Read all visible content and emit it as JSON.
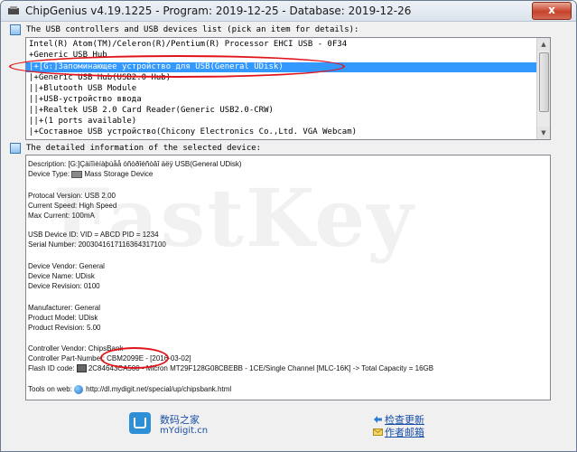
{
  "window": {
    "title": "ChipGenius v4.19.1225 - Program: 2019-12-25 - Database: 2019-12-26",
    "close_label": "x"
  },
  "devices_section": {
    "header": "The USB controllers and USB devices list (pick an item for details):",
    "items": [
      "Intel(R) Atom(TM)/Celeron(R)/Pentium(R) Processor EHCI USB - 0F34",
      "+Generic USB Hub",
      "|+[G:]Запоминающее устройство для USB(General UDisk)",
      "|+Generic USB Hub(USB2.0 Hub)",
      "||+Blutooth USB Module",
      "||+USB-устройство ввода",
      "||+Realtek USB 2.0 Card Reader(Generic USB2.0-CRW)",
      "||+(1 ports available)",
      "|+Составное USB устройство(Chicony Electronics Co.,Ltd. VGA Webcam)"
    ],
    "selected_index": 2
  },
  "details_section": {
    "header": "The detailed information of the selected device:",
    "lines": [
      {
        "label": "Description:",
        "value": "[G:]Çàïîìèíàþùåå óñòðîéñòâî äëÿ USB(General UDisk)"
      },
      {
        "label": "Device Type:",
        "value": "Mass Storage Device"
      },
      {
        "label": "Protocal Version:",
        "value": "USB 2.00"
      },
      {
        "label": "Current Speed:",
        "value": "High Speed"
      },
      {
        "label": "Max Current:",
        "value": "100mA"
      },
      {
        "label": "USB Device ID:",
        "value": "VID = ABCD PID = 1234"
      },
      {
        "label": "Serial Number:",
        "value": "2003041617116364317100"
      },
      {
        "label": "Device Vendor:",
        "value": "General"
      },
      {
        "label": "Device Name:",
        "value": "UDisk"
      },
      {
        "label": "Device Revision:",
        "value": "0100"
      },
      {
        "label": "Manufacturer:",
        "value": "General"
      },
      {
        "label": "Product Model:",
        "value": "UDisk"
      },
      {
        "label": "Product Revision:",
        "value": "5.00"
      },
      {
        "label": "Controller Vendor:",
        "value": "ChipsBank"
      },
      {
        "label": "Controller Part-Number:",
        "value": "CBM2099E - [2016-03-02]"
      },
      {
        "label": "Flash ID code:",
        "value": "2C84643CA500 - Micron MT29F128G08CBEBB - 1CE/Single Channel [MLC-16K] -> Total Capacity = 16GB"
      },
      {
        "label": "Tools on web:",
        "value": "http://dl.mydigit.net/special/up/chipsbank.html"
      }
    ]
  },
  "watermark": "FastKey",
  "footer": {
    "site_cn": "数码之家",
    "site_en": "mYdigit.cn",
    "check_update": "检查更新",
    "author_mail": "作者邮箱"
  },
  "colors": {
    "selection": "#3399ff",
    "highlight_oval": "#e0141b",
    "link": "#1a4fa8"
  }
}
